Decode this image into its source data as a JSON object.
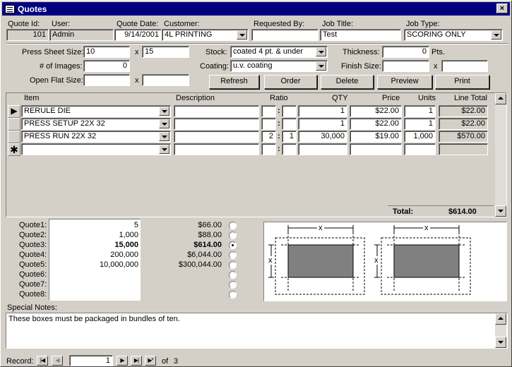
{
  "window": {
    "title": "Quotes",
    "close": "×"
  },
  "header": {
    "quote_id": {
      "label": "Quote Id:",
      "value": "101"
    },
    "user": {
      "label": "User:",
      "value": "Admin"
    },
    "quote_date": {
      "label": "Quote Date:",
      "value": "9/14/2001"
    },
    "customer": {
      "label": "Customer:",
      "value": "4L PRINTING"
    },
    "requested_by": {
      "label": "Requested By:",
      "value": ""
    },
    "job_title": {
      "label": "Job Title:",
      "value": "Test"
    },
    "job_type": {
      "label": "Job Type:",
      "value": "SCORING ONLY"
    }
  },
  "specs": {
    "press_sheet_size": {
      "label": "Press Sheet Size:",
      "w": "10",
      "x": "x",
      "h": "15"
    },
    "num_images": {
      "label": "# of Images:",
      "value": "0"
    },
    "open_flat_size": {
      "label": "Open Flat Size:",
      "w": "",
      "x": "x",
      "h": ""
    },
    "stock": {
      "label": "Stock:",
      "value": "coated 4 pt. & under"
    },
    "coating": {
      "label": "Coating:",
      "value": "u.v. coating"
    },
    "thickness": {
      "label": "Thickness:",
      "value": "0",
      "unit": "Pts."
    },
    "finish_size": {
      "label": "Finish Size:",
      "w": "",
      "x": "x",
      "h": ""
    }
  },
  "buttons": {
    "refresh": "Refresh",
    "order": "Order",
    "delete": "Delete",
    "preview": "Preview",
    "print": "Print"
  },
  "items": {
    "headers": {
      "item": "Item",
      "description": "Description",
      "ratio": "Ratio",
      "qty": "QTY",
      "price": "Price",
      "units": "Units",
      "line_total": "Line Total"
    },
    "rows": [
      {
        "item": "RERULE DIE",
        "description": "",
        "ratio_a": "",
        "ratio_b": "",
        "qty": "1",
        "price": "$22.00",
        "units": "1",
        "line_total": "$22.00"
      },
      {
        "item": "PRESS SETUP 22X 32",
        "description": "",
        "ratio_a": "",
        "ratio_b": "",
        "qty": "1",
        "price": "$22.00",
        "units": "1",
        "line_total": "$22.00"
      },
      {
        "item": " PRESS RUN 22X 32",
        "description": "",
        "ratio_a": "2",
        "ratio_b": "1",
        "qty": "30,000",
        "price": "$19.00",
        "units": "1,000",
        "line_total": "$570.00"
      }
    ],
    "total_label": "Total:",
    "total_value": "$614.00"
  },
  "quotes": {
    "labels": [
      "Quote1:",
      "Quote2:",
      "Quote3:",
      "Quote4:",
      "Quote5:",
      "Quote6:",
      "Quote7:",
      "Quote8:"
    ],
    "qtys": [
      "5",
      "1,000",
      "15,000",
      "200,000",
      "10,000,000",
      "",
      "",
      ""
    ],
    "prices": [
      "$66.00",
      "$88.00",
      "$614.00",
      "$6,044.00",
      "$300,044.00",
      "",
      "",
      ""
    ],
    "selected_index": 2
  },
  "diagram": {
    "dim_x": "x"
  },
  "notes": {
    "label": "Special Notes:",
    "value": "These boxes must be packaged in bundles of ten."
  },
  "record_nav": {
    "label": "Record:",
    "current": "1",
    "of": "of",
    "total": "3"
  }
}
